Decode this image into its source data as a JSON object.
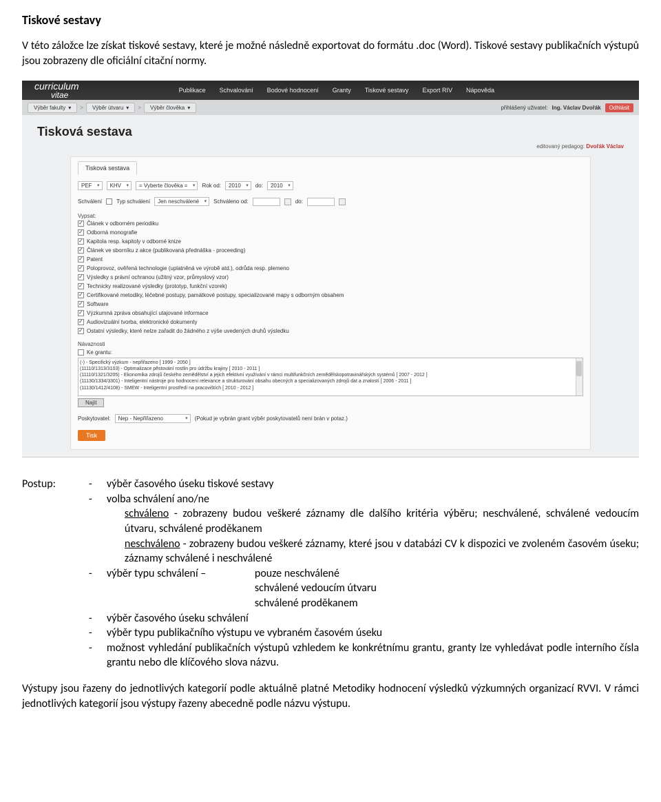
{
  "doc": {
    "title": "Tiskové sestavy",
    "intro": "V této záložce lze získat tiskové sestavy, které je možné následně exportovat do formátu .doc (Word). Tiskové sestavy publikačních výstupů jsou zobrazeny dle oficiální citační normy."
  },
  "screenshot": {
    "logo_line1": "curriculum",
    "logo_line2": "vitae",
    "nav_tabs": [
      "Publikace",
      "Schvalování",
      "Bodové hodnocení",
      "Granty",
      "Tiskové sestavy",
      "Export RIV",
      "Nápověda"
    ],
    "breadcrumbs": [
      "Výběr fakulty",
      "Výběr útvaru",
      "Výběr člověka"
    ],
    "user_label": "přihlášený uživatel:",
    "user_name": "Ing. Václav Dvořák",
    "logout": "Odhlásit",
    "editor_label": "editovaný pedagog:",
    "editor_name": "Dvořák Václav",
    "heading": "Tisková sestava",
    "panel_tab": "Tisková sestava",
    "filters": {
      "pef": "PEF",
      "khv": "KHV",
      "person_placeholder": "= Vyberte člověka =",
      "rok_od_label": "Rok od:",
      "rok_od": "2010",
      "rok_do_label": "do:",
      "rok_do": "2010",
      "schvaleni_label": "Schválení",
      "typ_label": "Typ schválení",
      "typ_value": "Jen neschválené",
      "schvaleno_od": "Schváleno od:",
      "do": "do:"
    },
    "vypsat_label": "Vypsat:",
    "checklist": [
      "Článek v odborném periodiku",
      "Odborná monografie",
      "Kapitola resp. kapitoly v odborné knize",
      "Článek ve sborníku z akce (publikovaná přednáška - proceeding)",
      "Patent",
      "Poloprovoz, ověřená technologie (uplatněná ve výrobě atd.), odrůda resp. plemeno",
      "Výsledky s právní ochranou (užitný vzor, průmyslový vzor)",
      "Technicky realizované výsledky (prototyp, funkční vzorek)",
      "Certifikované metodiky, léčebné postupy, památkové postupy, specializované mapy s odborným obsahem",
      "Software",
      "Výzkumná zpráva obsahující utajované informace",
      "Audiovizuální tvorba, elektronické dokumenty",
      "Ostatní výsledky, které nelze zařadit do žádného z výše uvedených druhů výsledku"
    ],
    "navaznosti_label": "Návaznosti",
    "ke_grantu_label": "Ke grantu:",
    "grant_lines": [
      "(-) - Specifický výzkum - nepřiřazeno [ 1999 - 2050 ]",
      "(11110/1313/3103) - Optimalizace pěstování rostlin pro údržbu krajiny [ 2010 - 2011 ]",
      "(11110/1321/3205) - Ekonomika zdrojů českého zemědělství a jejich efektivní využívání v rámci multifunkčních zemědělskopotravinářských systémů [ 2007 - 2012 ]",
      "(11130/1334/3301) - Inteligentní nástroje pro hodnocení relevance a strukturování obsahu obecných a specializovaných zdrojů dat a znalostí [ 2006 - 2011 ]",
      "(11130/1412/4108) - SMEW - Inteligentní prostředí na pracovištích [ 2010 - 2012 ]"
    ],
    "najit": "Najít",
    "poskytovatel_label": "Poskytovatel:",
    "poskytovatel_value": "Nep - Nepřiřazeno",
    "poskytovatel_note": "(Pokud je vybrán grant výběr poskytovatelů není brán v potaz.)",
    "tisk": "Tisk"
  },
  "postup": {
    "label": "Postup:",
    "items": {
      "i1": "výběr časového úseku tiskové sestavy",
      "i2": "volba schválení ano/ne",
      "i2a_l": "schváleno",
      "i2a_r": " - zobrazeny budou veškeré záznamy dle dalšího kritéria výběru; neschválené, schválené vedoucím útvaru, schválené proděkanem",
      "i2b_l": "neschváleno",
      "i2b_r": " - zobrazeny budou veškeré záznamy, které jsou v databázi CV k dispozici ve zvoleném časovém úseku; záznamy schválené i neschválené",
      "i3_l": "výběr typu schválení – ",
      "i3_r1": "pouze neschválené",
      "i3_r2": "schválené vedoucím útvaru",
      "i3_r3": "schválené proděkanem",
      "i4": "výběr časového úseku schválení",
      "i5": "výběr typu publikačního výstupu ve vybraném časovém úseku",
      "i6": "možnost vyhledání publikačních výstupů vzhledem ke konkrétnímu grantu, granty lze vyhledávat podle interního čísla grantu nebo dle klíčového slova názvu."
    }
  },
  "footer": "Výstupy jsou řazeny do jednotlivých kategorií podle aktuálně platné Metodiky hodnocení výsledků výzkumných organizací RVVI. V rámci jednotlivých kategorií jsou výstupy řazeny abecedně podle názvu výstupu."
}
